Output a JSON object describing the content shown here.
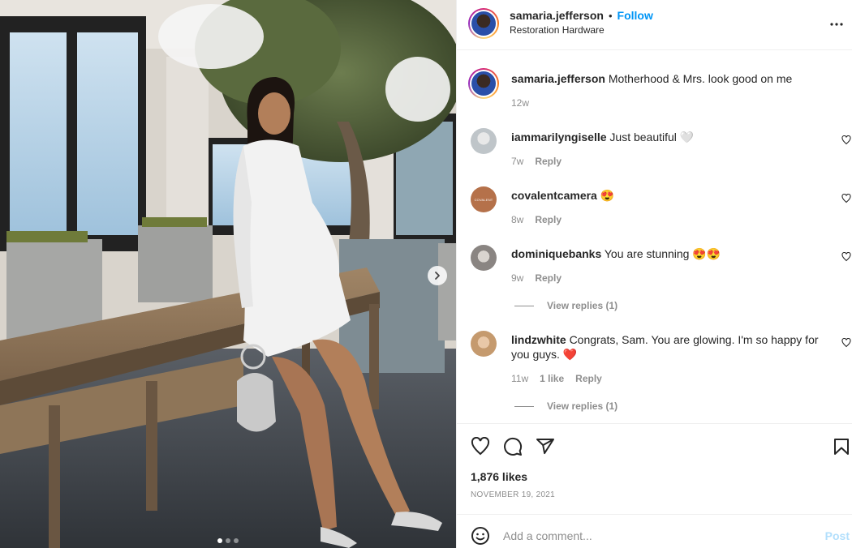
{
  "post": {
    "carousel": {
      "slide_count": 3,
      "active_slide": 1
    },
    "header": {
      "username": "samaria.jefferson",
      "separator": "•",
      "follow_label": "Follow",
      "location": "Restoration Hardware"
    },
    "caption": {
      "username": "samaria.jefferson",
      "text": "Motherhood & Mrs. look good on me",
      "time": "12w"
    },
    "comments": [
      {
        "username": "iammarilyngiselle",
        "text": "Just beautiful 🤍",
        "time": "7w",
        "reply_label": "Reply"
      },
      {
        "username": "covalentcamera",
        "text": "😍",
        "time": "8w",
        "reply_label": "Reply",
        "avatar_text": "COVALENT"
      },
      {
        "username": "dominiquebanks",
        "text": "You are stunning 😍😍",
        "time": "9w",
        "reply_label": "Reply",
        "view_replies": "View replies (1)"
      },
      {
        "username": "lindzwhite",
        "text": "Congrats, Sam. You are glowing. I'm so happy for you guys. ❤️",
        "time": "11w",
        "likes": "1 like",
        "reply_label": "Reply",
        "view_replies": "View replies (1)"
      }
    ],
    "likes": "1,876 likes",
    "date": "NOVEMBER 19, 2021",
    "add_comment": {
      "placeholder": "Add a comment...",
      "post_label": "Post"
    }
  },
  "colors": {
    "accent": "#0095f6",
    "post_disabled": "#b2dffc",
    "muted": "#8e8e8e",
    "like_red": "#ed4956"
  }
}
